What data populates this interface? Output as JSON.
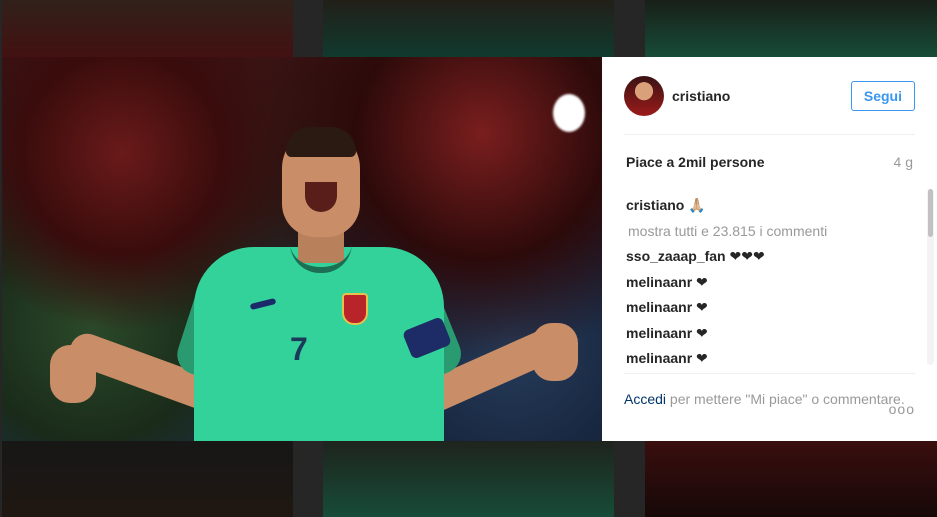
{
  "post": {
    "username": "cristiano",
    "follow_label": "Segui",
    "likes_text": "Piace a 2mil persone",
    "time_ago": "4 g"
  },
  "comments": [
    {
      "user": "cristiano",
      "text": "🙏🏼"
    },
    {
      "show_all": "mostra tutti e 23.815 i commenti"
    },
    {
      "user": "sso_zaaap_fan",
      "text": "❤❤❤"
    },
    {
      "user": "melinaanr",
      "text": "❤"
    },
    {
      "user": "melinaanr",
      "text": "❤"
    },
    {
      "user": "melinaanr",
      "text": "❤"
    },
    {
      "user": "melinaanr",
      "text": "❤"
    }
  ],
  "footer": {
    "login_label": "Accedi",
    "login_rest": "per mettere \"Mi piace\" o commentare.",
    "more_label": "ooo"
  },
  "colors": {
    "accent": "#3897f0",
    "text": "#262626",
    "muted": "#999999",
    "link": "#003569"
  }
}
